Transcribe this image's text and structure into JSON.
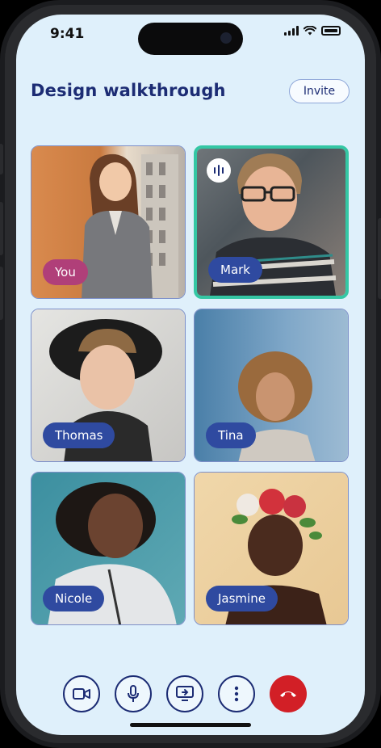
{
  "status": {
    "time": "9:41"
  },
  "header": {
    "title": "Design walkthrough",
    "invite_label": "Invite"
  },
  "participants": [
    {
      "name": "You",
      "is_self": true,
      "speaking": false
    },
    {
      "name": "Mark",
      "is_self": false,
      "speaking": true
    },
    {
      "name": "Thomas",
      "is_self": false,
      "speaking": false
    },
    {
      "name": "Tina",
      "is_self": false,
      "speaking": false
    },
    {
      "name": "Nicole",
      "is_self": false,
      "speaking": false
    },
    {
      "name": "Jasmine",
      "is_self": false,
      "speaking": false
    }
  ],
  "controls": [
    "video-camera-icon",
    "microphone-icon",
    "screen-share-icon",
    "more-vertical-icon",
    "end-call-icon"
  ],
  "colors": {
    "title": "#1c2c74",
    "name_badge": "#2f4aa0",
    "self_badge": "#b03f79",
    "speaking_border": "#34c7a4",
    "end_call": "#d21f26",
    "screen_bg": "#dff0fb"
  }
}
